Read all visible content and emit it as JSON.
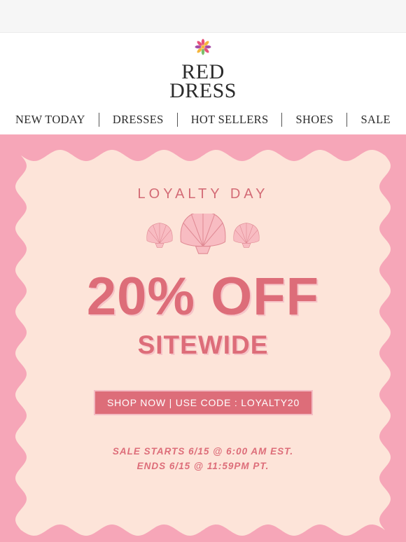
{
  "header": {
    "brand_line1": "RED",
    "brand_line2": "DRESS",
    "logo_icon": "flower-icon",
    "logo_colors": [
      "#e8527a",
      "#f5b53c",
      "#a64ca6",
      "#7bbf6a"
    ]
  },
  "nav": {
    "items": [
      "NEW TODAY",
      "DRESSES",
      "HOT SELLERS",
      "SHOES",
      "SALE"
    ]
  },
  "promo": {
    "eyebrow": "LOYALTY DAY",
    "headline": "20% OFF",
    "subheadline": "SITEWIDE",
    "cta_label": "SHOP NOW | USE CODE : LOYALTY20",
    "sale_start": "SALE  STARTS 6/15 @ 6:00 AM EST.",
    "sale_end": "ENDS 6/15 @ 11:59PM PT.",
    "decoration_icon": "seashell-icon",
    "colors": {
      "background": "#f6a6b8",
      "card": "#fde4d9",
      "accent": "#dd6d79"
    }
  }
}
